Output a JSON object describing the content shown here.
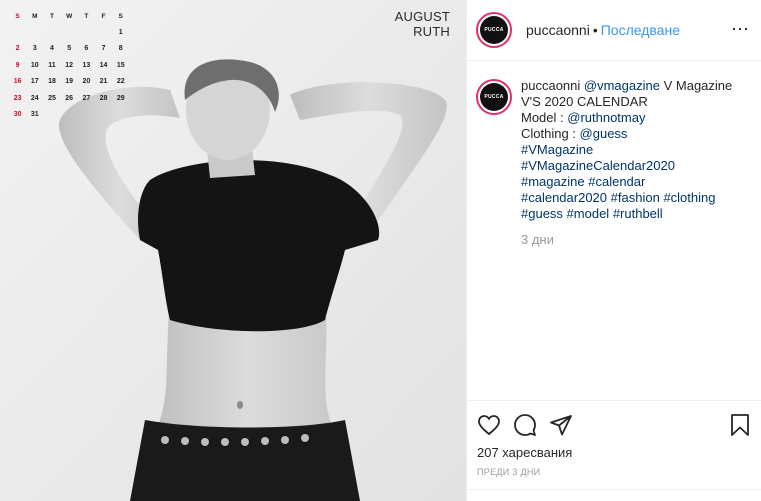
{
  "photo": {
    "month_title_line1": "AUGUST",
    "month_title_line2": "RUTH",
    "calendar": {
      "weekdays": [
        "S",
        "M",
        "T",
        "W",
        "T",
        "F",
        "S"
      ],
      "weeks": [
        [
          "",
          "",
          "",
          "",
          "",
          "",
          "1"
        ],
        [
          "2",
          "3",
          "4",
          "5",
          "6",
          "7",
          "8"
        ],
        [
          "9",
          "10",
          "11",
          "12",
          "13",
          "14",
          "15"
        ],
        [
          "16",
          "17",
          "18",
          "19",
          "20",
          "21",
          "22"
        ],
        [
          "23",
          "24",
          "25",
          "26",
          "27",
          "28",
          "29"
        ],
        [
          "30",
          "31",
          "",
          "",
          "",
          "",
          ""
        ]
      ]
    }
  },
  "header": {
    "avatar_text": "PUCCA",
    "username": "puccaonni",
    "dot": "•",
    "follow_label": "Последване",
    "more": "⋯"
  },
  "caption": {
    "avatar_text": "PUCCA",
    "username": "puccaonni",
    "mention_vmagazine": "@vmagazine",
    "line1_rest": " V Magazine",
    "line2": "V'S 2020 CALENDAR",
    "model_label": "Model : ",
    "model_handle": "@ruthnotmay",
    "clothing_label": "Clothing : ",
    "clothing_handle": "@guess",
    "tag_vmagazine": "#VMagazine",
    "tag_vmagcal": "#VMagazineCalendar2020",
    "tag_magazine": "#magazine",
    "tag_calendar": "#calendar",
    "tag_calendar2020": "#calendar2020",
    "tag_fashion": "#fashion",
    "tag_clothing": "#clothing",
    "tag_guess": "#guess",
    "tag_model": "#model",
    "tag_ruthbell": "#ruthbell",
    "time_ago": "3 дни"
  },
  "footer": {
    "likes": "207 харесвания",
    "date": "ПРЕДИ 3 ДНИ"
  },
  "colors": {
    "link": "#003569",
    "follow": "#3897f0",
    "avatar_ring": "#e1306c",
    "sunday_red": "#c8102e"
  }
}
